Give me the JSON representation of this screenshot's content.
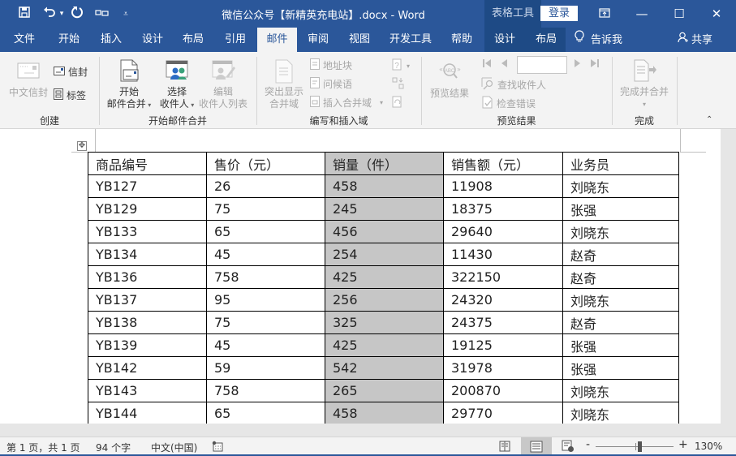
{
  "titlebar": {
    "title": "微信公众号【新精英充电站】.docx  -  Word",
    "context_group": "表格工具",
    "login_label": "登录",
    "quick_access": {
      "save_icon": "save-icon",
      "undo_icon": "undo-icon",
      "undo_dropdown": "▾",
      "redo_icon": "redo-icon",
      "touch_mode_icon": "touch-mode-icon",
      "customize_icon": "customize-icon"
    },
    "window_buttons": {
      "ribbon_display": "⊡",
      "minimize": "—",
      "maximize": "☐",
      "close": "✕"
    }
  },
  "tabs": {
    "items": [
      "文件",
      "开始",
      "插入",
      "设计",
      "布局",
      "引用",
      "邮件",
      "审阅",
      "视图",
      "开发工具",
      "帮助"
    ],
    "active": "邮件",
    "context_items": [
      "设计",
      "布局"
    ],
    "tell_me": "告诉我",
    "share": "共享"
  },
  "ribbon": {
    "groups": {
      "create": {
        "label": "创建",
        "chinese_envelope": "中文信封",
        "envelopes": "信封",
        "labels": "标签"
      },
      "start_mail_merge": {
        "label": "开始邮件合并",
        "start_line1": "开始",
        "start_line2": "邮件合并",
        "select_line1": "选择",
        "select_line2": "收件人",
        "edit_line1": "编辑",
        "edit_line2": "收件人列表"
      },
      "write_insert": {
        "label": "编写和插入域",
        "highlight_line1": "突出显示",
        "highlight_line2": "合并域",
        "address_block": "地址块",
        "greeting_line": "问候语",
        "insert_merge_field": "插入合并域"
      },
      "preview": {
        "label": "预览结果",
        "preview_results": "预览结果",
        "record_value": "",
        "find_recipient": "查找收件人",
        "check_errors": "检查错误"
      },
      "finish": {
        "label": "完成",
        "finish_merge": "完成并合并"
      }
    }
  },
  "table": {
    "headers": [
      "商品编号",
      "售价（元）",
      "销量（件）",
      "销售额（元）",
      "业务员"
    ],
    "selected_column": 2,
    "rows": [
      [
        "YB127",
        "26",
        "458",
        "11908",
        "刘晓东"
      ],
      [
        "YB129",
        "75",
        "245",
        "18375",
        "张强"
      ],
      [
        "YB133",
        "65",
        "456",
        "29640",
        "刘晓东"
      ],
      [
        "YB134",
        "45",
        "254",
        "11430",
        "赵奇"
      ],
      [
        "YB136",
        "758",
        "425",
        "322150",
        "赵奇"
      ],
      [
        "YB137",
        "95",
        "256",
        "24320",
        "刘晓东"
      ],
      [
        "YB138",
        "75",
        "325",
        "24375",
        "赵奇"
      ],
      [
        "YB139",
        "45",
        "425",
        "19125",
        "张强"
      ],
      [
        "YB142",
        "59",
        "542",
        "31978",
        "张强"
      ],
      [
        "YB143",
        "758",
        "265",
        "200870",
        "刘晓东"
      ],
      [
        "YB144",
        "65",
        "458",
        "29770",
        "刘晓东"
      ]
    ]
  },
  "statusbar": {
    "page": "第 1 页，共 1 页",
    "words": "94 个字",
    "language": "中文(中国)",
    "zoom": "130%",
    "zoom_minus": "-",
    "zoom_plus": "+",
    "zoom_level_percent": 130
  }
}
